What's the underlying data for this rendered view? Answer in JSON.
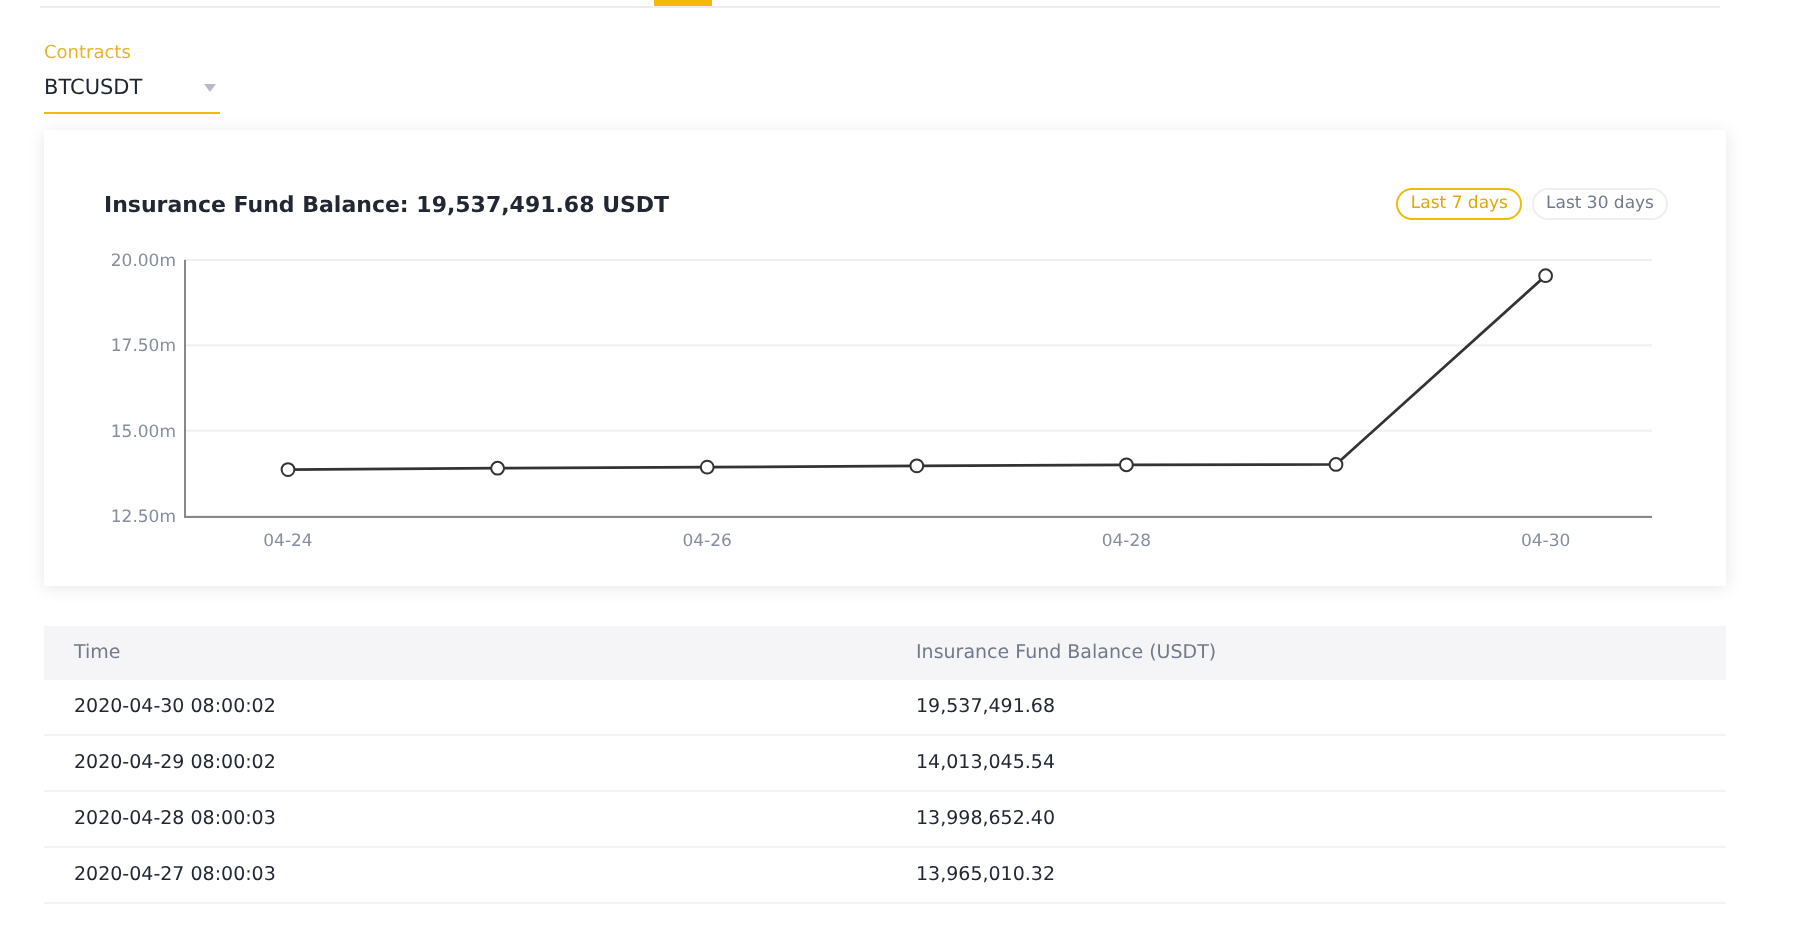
{
  "contract_selector": {
    "label": "Contracts",
    "value": "BTCUSDT"
  },
  "chart_card": {
    "title": "Insurance Fund Balance: 19,537,491.68 USDT",
    "ranges": [
      {
        "label": "Last 7 days",
        "selected": true
      },
      {
        "label": "Last 30 days",
        "selected": false
      }
    ],
    "chart_data": {
      "type": "line",
      "categories": [
        "04-24",
        null,
        "04-26",
        null,
        "04-28",
        null,
        "04-30"
      ],
      "series": [
        {
          "color": "#333333",
          "marker": "circle",
          "values": [
            13.86,
            13.9,
            13.93,
            13.97,
            14.0,
            14.01,
            19.54
          ]
        }
      ],
      "ylim": [
        12.5,
        20
      ],
      "yticks": [
        {
          "value": 12.5,
          "label": "12.50m"
        },
        {
          "value": 15,
          "label": "15.00m"
        },
        {
          "value": 17.5,
          "label": "17.50m"
        },
        {
          "value": 20,
          "label": "20.00m"
        }
      ]
    }
  },
  "table": {
    "columns": [
      "Time",
      "Insurance Fund Balance (USDT)"
    ],
    "rows": [
      [
        "2020-04-30 08:00:02",
        "19,537,491.68"
      ],
      [
        "2020-04-29 08:00:02",
        "14,013,045.54"
      ],
      [
        "2020-04-28 08:00:03",
        "13,998,652.40"
      ],
      [
        "2020-04-27 08:00:03",
        "13,965,010.32"
      ]
    ]
  }
}
